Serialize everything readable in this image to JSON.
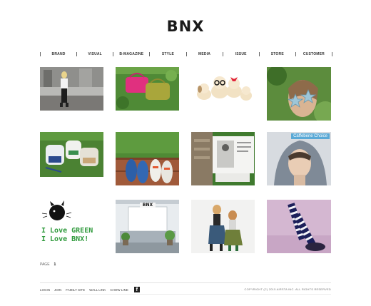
{
  "brand": {
    "logo": "BNX"
  },
  "nav": {
    "items": [
      "BRAND",
      "VISUAL",
      "B-MAGAZINE",
      "STYLE",
      "MEDIA",
      "ISSUE",
      "STORE",
      "CUSTOMER"
    ]
  },
  "tiles": {
    "t8_badge": "Caffebene Choice",
    "t9_line1": "I Love GREEN",
    "t9_line2": "I Love BNX!",
    "t10_sign": "BNX"
  },
  "pager": {
    "label": "PAGE",
    "current": "1"
  },
  "footer": {
    "links": [
      "LOGIN",
      "JOIN",
      "FAMILY SITE",
      "WALL LINK",
      "CHOW LINE"
    ],
    "facebook": "f",
    "copyright": "COPYRIGHT (C) 2015 AIRSTA INC. ALL RIGHTS RESERVED"
  },
  "colors": {
    "accent_green": "#2f9a3c",
    "badge_blue": "#5aa9d6"
  }
}
